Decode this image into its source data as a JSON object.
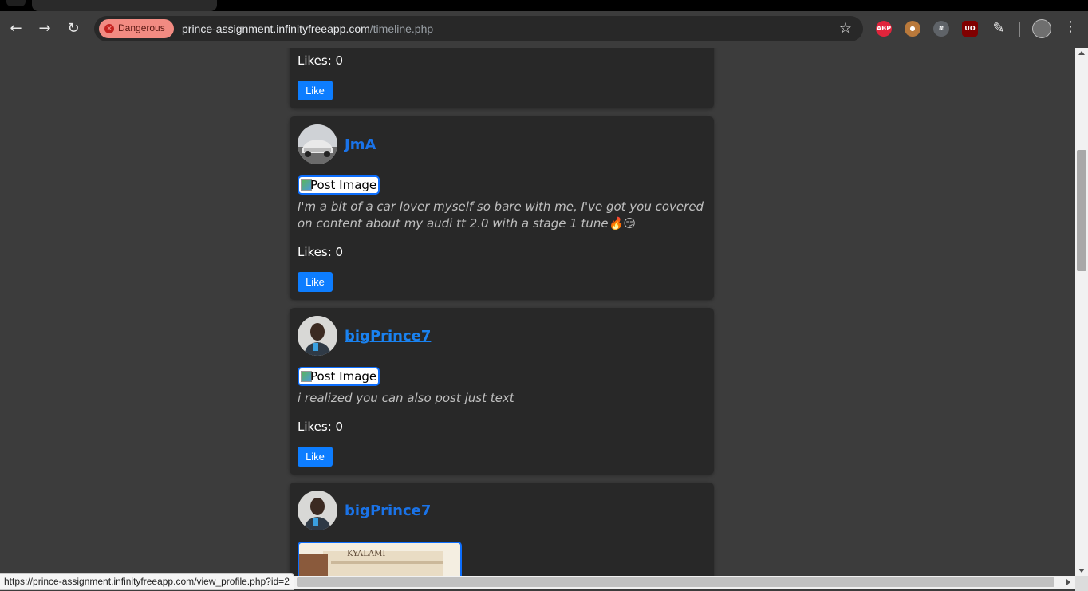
{
  "browser": {
    "security_chip": "Dangerous",
    "url_domain": "prince-assignment.infinityfreeapp.com",
    "url_path": "/timeline.php",
    "extensions": [
      {
        "name": "adblock-plus-icon",
        "label": "ABP",
        "color": "#e0243b"
      },
      {
        "name": "cookie-extension-icon",
        "label": "",
        "color": "#b9793b"
      },
      {
        "name": "hash-extension-icon",
        "label": "#",
        "color": "#5f6368"
      },
      {
        "name": "ublock-origin-icon",
        "label": "UO",
        "color": "#800000"
      }
    ]
  },
  "posts": [
    {
      "likes": "Likes: 0",
      "like_button": "Like"
    },
    {
      "username": "JmA",
      "image_alt": "Post Image",
      "caption": "I'm a bit of a car lover myself so bare with me, I've got you covered on content about my audi tt 2.0 with a stage 1 tune🔥😏",
      "likes": "Likes: 0",
      "like_button": "Like"
    },
    {
      "username": "bigPrince7",
      "image_alt": "Post Image",
      "caption": "i realized you can also post just text",
      "likes": "Likes: 0",
      "like_button": "Like"
    },
    {
      "username": "bigPrince7",
      "image_text": "KYALAMI"
    }
  ],
  "status_bar": {
    "hover_url": "https://prince-assignment.infinityfreeapp.com/view_profile.php?id=2"
  },
  "colors": {
    "page_bg": "#3c3c3c",
    "card_bg": "#282828",
    "link": "#1a73e8",
    "button": "#0d7dff",
    "danger": "#f28b82"
  }
}
